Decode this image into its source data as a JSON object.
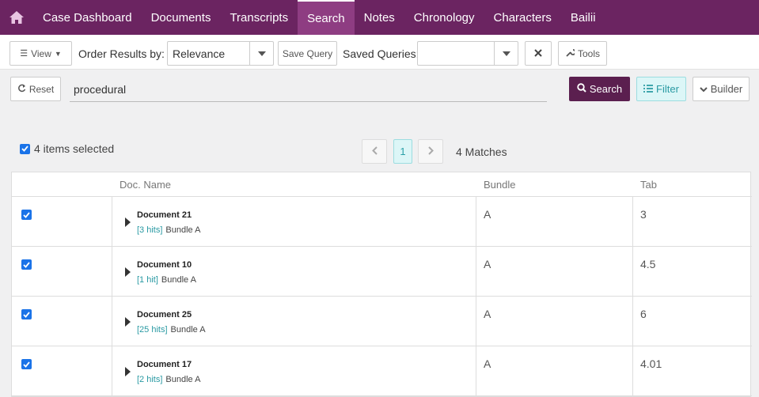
{
  "nav": {
    "items": [
      "Case Dashboard",
      "Documents",
      "Transcripts",
      "Search",
      "Notes",
      "Chronology",
      "Characters",
      "Bailii"
    ],
    "active": "Search"
  },
  "toolbar": {
    "view_label": "View",
    "order_label": "Order Results by:",
    "order_value": "Relevance",
    "save_query_label": "Save Query",
    "saved_queries_label": "Saved Queries:",
    "saved_queries_value": "",
    "tools_label": "Tools"
  },
  "search": {
    "reset_label": "Reset",
    "query": "procedural",
    "search_label": "Search",
    "filter_label": "Filter",
    "builder_label": "Builder"
  },
  "selection": {
    "text": "4 items selected"
  },
  "pager": {
    "current": "1",
    "matches": "4 Matches"
  },
  "table": {
    "headers": {
      "name": "Doc. Name",
      "bundle": "Bundle",
      "tab": "Tab"
    },
    "rows": [
      {
        "name": "Document 21",
        "hits": "[3 hits]",
        "bundle_label": "Bundle A",
        "bundle": "A",
        "tab": "3"
      },
      {
        "name": "Document 10",
        "hits": "[1 hit]",
        "bundle_label": "Bundle A",
        "bundle": "A",
        "tab": "4.5"
      },
      {
        "name": "Document 25",
        "hits": "[25 hits]",
        "bundle_label": "Bundle A",
        "bundle": "A",
        "tab": "6"
      },
      {
        "name": "Document 17",
        "hits": "[2 hits]",
        "bundle_label": "Bundle A",
        "bundle": "A",
        "tab": "4.01"
      }
    ]
  },
  "colors": {
    "nav_bg": "#6b2461",
    "nav_active": "#8e3d82",
    "search_btn": "#5b1f4f",
    "filter_bg": "#dcf6f7",
    "accent": "#2a9aa3",
    "checkbox": "#1a73e8"
  }
}
